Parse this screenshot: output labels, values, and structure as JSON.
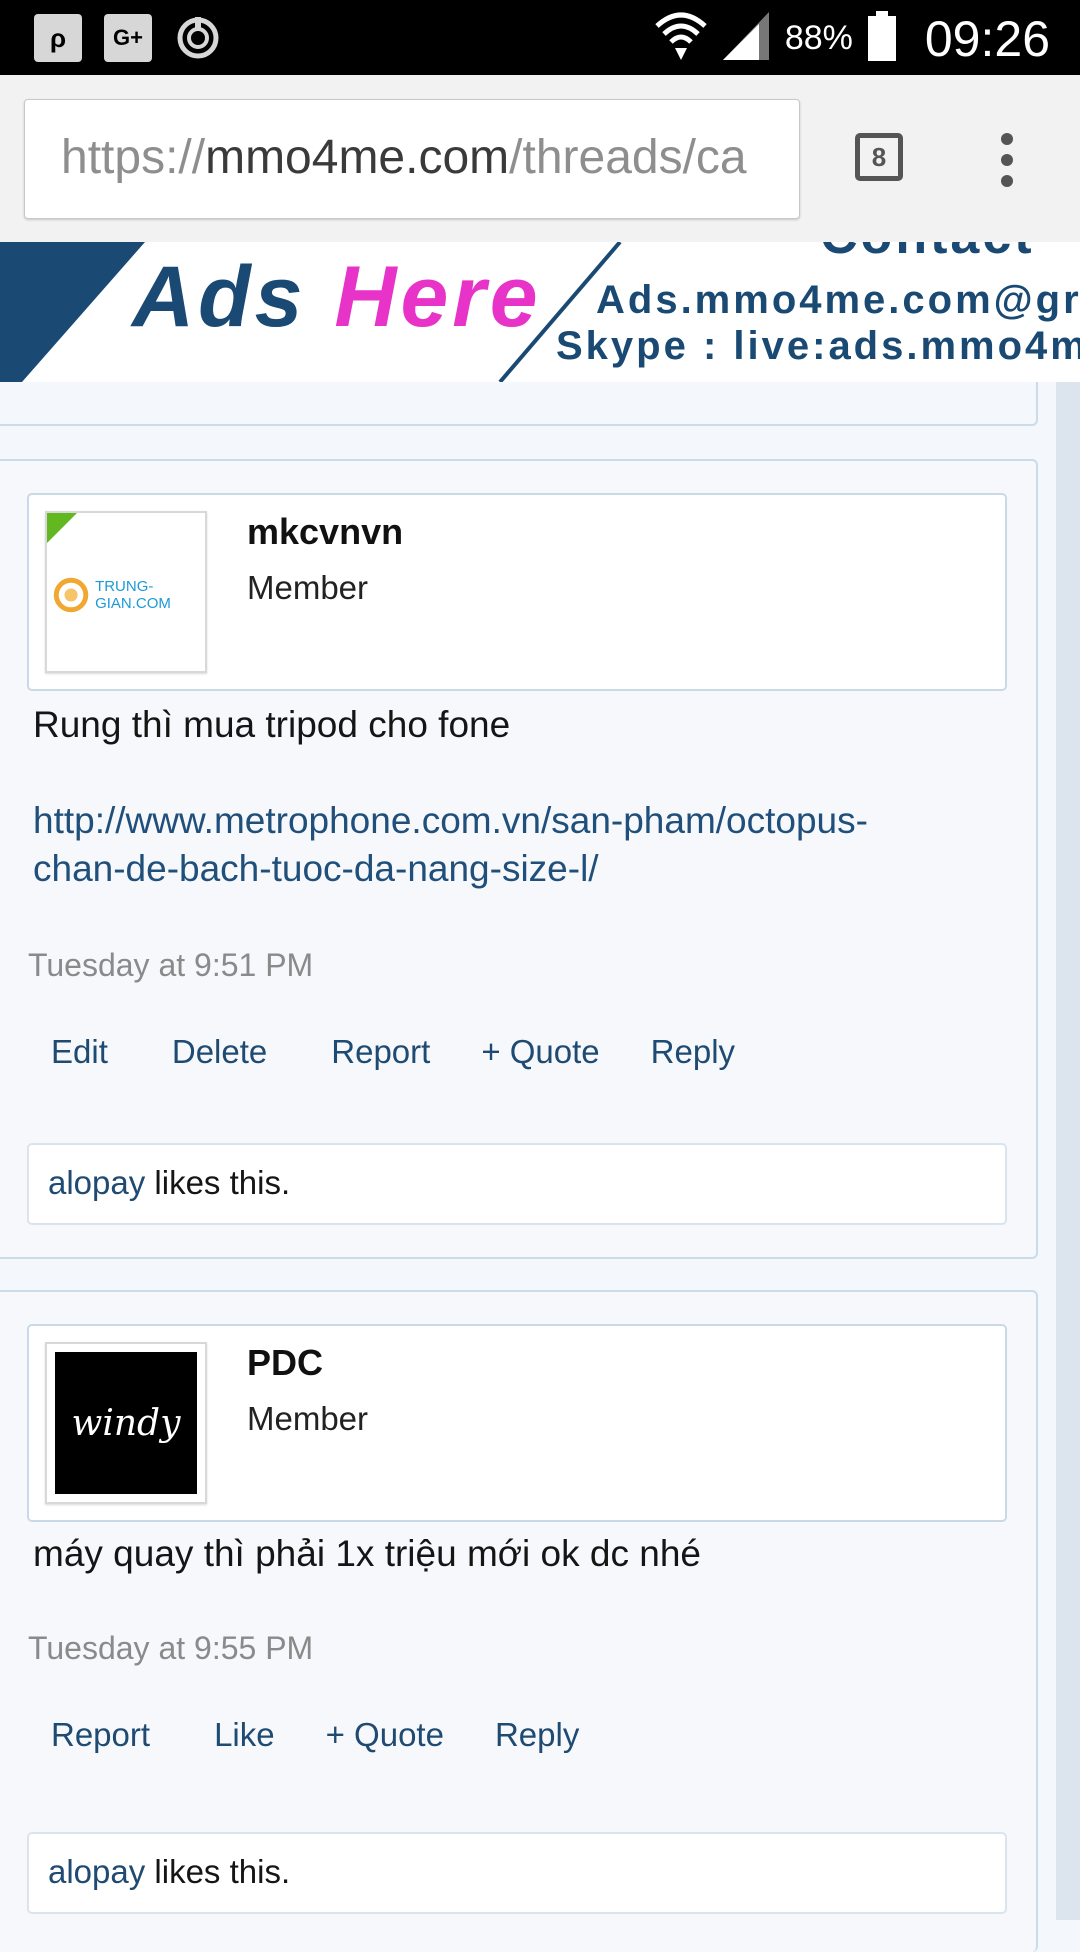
{
  "status_bar": {
    "left_icons": [
      "quora-icon",
      "google-plus-icon",
      "power-sync-icon"
    ],
    "gplus_glyph": "G+",
    "quora_glyph": "ρ",
    "battery_percent": "88%",
    "time": "09:26"
  },
  "browser": {
    "url_scheme": "https://",
    "url_domain": "mmo4me.com",
    "url_path": "/threads/ca",
    "tab_count": "8"
  },
  "banner": {
    "text_main": "Ads ",
    "text_highlight": "Here",
    "text_contact": "Contact",
    "text_email": "Ads.mmo4me.com@gr",
    "text_skype": "Skype : live:ads.mmo4m"
  },
  "posts": [
    {
      "username": "mkcvnvn",
      "user_title": "Member",
      "avatar_text": "TRUNG-GIAN.COM",
      "online": true,
      "message": "Rung thì mua tripod cho fone",
      "link": "http://www.metrophone.com.vn/san-pham/octopus-chan-de-bach-tuoc-da-nang-size-l/",
      "link_line1": "http://www.metrophone.com.vn/san-pham/octopus-",
      "link_line2": "chan-de-bach-tuoc-da-nang-size-l/",
      "date": "Tuesday at 9:51 PM",
      "actions": [
        "Edit",
        "Delete",
        "Report",
        "+ Quote",
        "Reply"
      ],
      "liker": "alopay",
      "likes_suffix": " likes this."
    },
    {
      "username": "PDC",
      "user_title": "Member",
      "avatar_text": "windy",
      "online": false,
      "message": "máy quay thì phải 1x triệu mới ok dc nhé",
      "date": "Tuesday at 9:55 PM",
      "actions": [
        "Report",
        "Like",
        "+ Quote",
        "Reply"
      ],
      "liker": "alopay",
      "likes_suffix": " likes this."
    }
  ],
  "colors": {
    "link": "#1f4a72",
    "banner_blue": "#1a4a73",
    "banner_pink": "#e833c9",
    "online_green": "#62b820"
  }
}
